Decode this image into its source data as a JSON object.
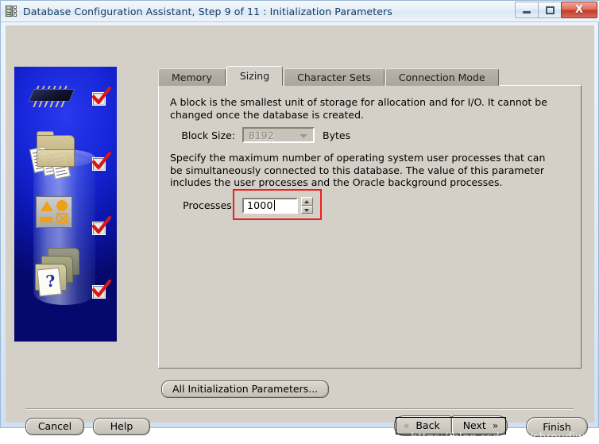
{
  "window": {
    "title": "Database Configuration Assistant, Step 9 of 11 : Initialization Parameters",
    "app_icon": "database-chip-icon",
    "controls": {
      "minimize": "minimize-icon",
      "restore": "restore-icon",
      "close_label": "X"
    }
  },
  "sidebar": {
    "items": [
      {
        "icon": "chip-icon",
        "checked": true
      },
      {
        "icon": "folder-documents-icon",
        "checked": true
      },
      {
        "icon": "shapes-panel-icon",
        "checked": true
      },
      {
        "icon": "folders-help-document-icon",
        "checked": true
      }
    ]
  },
  "tabs": [
    {
      "label": "Memory",
      "active": false
    },
    {
      "label": "Sizing",
      "active": true
    },
    {
      "label": "Character Sets",
      "active": false
    },
    {
      "label": "Connection Mode",
      "active": false
    }
  ],
  "sizing": {
    "block_description": "A block is the smallest unit of storage for allocation and for I/O. It cannot be changed once the database is created.",
    "block_size_label": "Block Size:",
    "block_size_value": "8192",
    "block_size_unit": "Bytes",
    "block_size_enabled": false,
    "processes_description": "Specify the maximum number of operating system user processes that can be simultaneously connected to this database. The value of this parameter includes the user processes and the Oracle background processes.",
    "processes_label": "Processes:",
    "processes_value": "1000",
    "highlight_color": "#ef1f1f"
  },
  "buttons": {
    "all_parameters": "All Initialization Parameters...",
    "cancel": "Cancel",
    "help": "Help",
    "back": "Back",
    "next": "Next",
    "finish": "Finish",
    "back_chevron": "chevron-double-left-icon",
    "next_chevron": "chevron-double-right-icon"
  },
  "watermark": "https://blog.csdn.net/shroudiwnl"
}
